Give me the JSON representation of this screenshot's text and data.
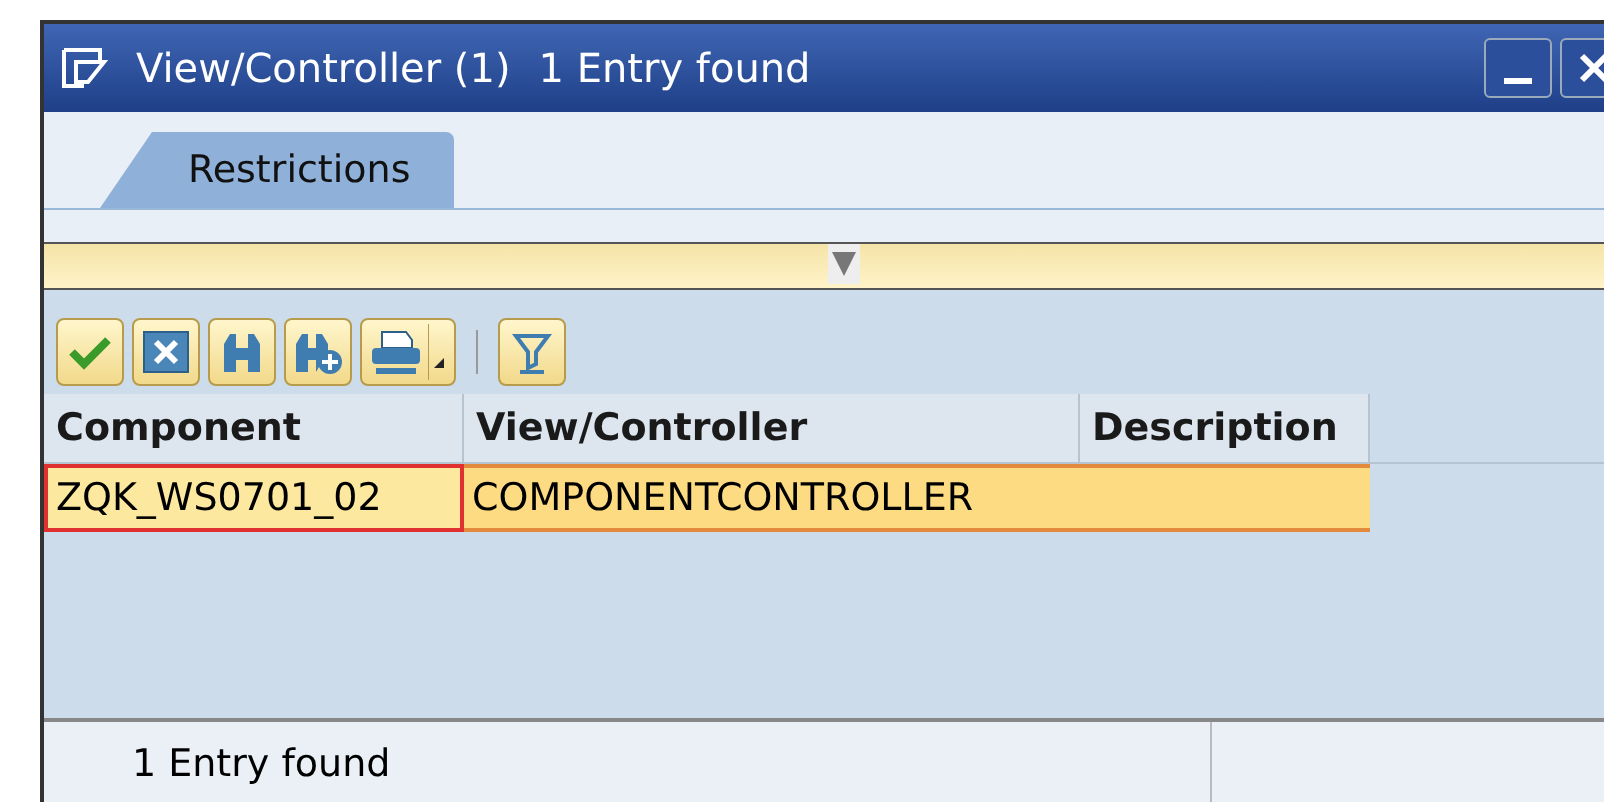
{
  "window": {
    "title": "View/Controller (1)",
    "subtitle": "1 Entry found"
  },
  "tabs": [
    {
      "label": "Restrictions",
      "selected": true
    }
  ],
  "toolbar": [
    {
      "kind": "check"
    },
    {
      "kind": "cancel"
    },
    {
      "kind": "find"
    },
    {
      "kind": "find-next"
    },
    {
      "kind": "print",
      "dropdown": true
    },
    {
      "kind": "separator"
    },
    {
      "kind": "filter"
    }
  ],
  "table": {
    "columns": [
      "Component",
      "View/Controller",
      "Description"
    ],
    "rows": [
      {
        "cells": [
          {
            "text": "ZQK_WS0701_02",
            "focused": true
          },
          {
            "text": "COMPONENTCONTROLLER",
            "focused": false
          }
        ],
        "selected": true
      }
    ]
  },
  "status_bar": {
    "text": "1 Entry found"
  }
}
